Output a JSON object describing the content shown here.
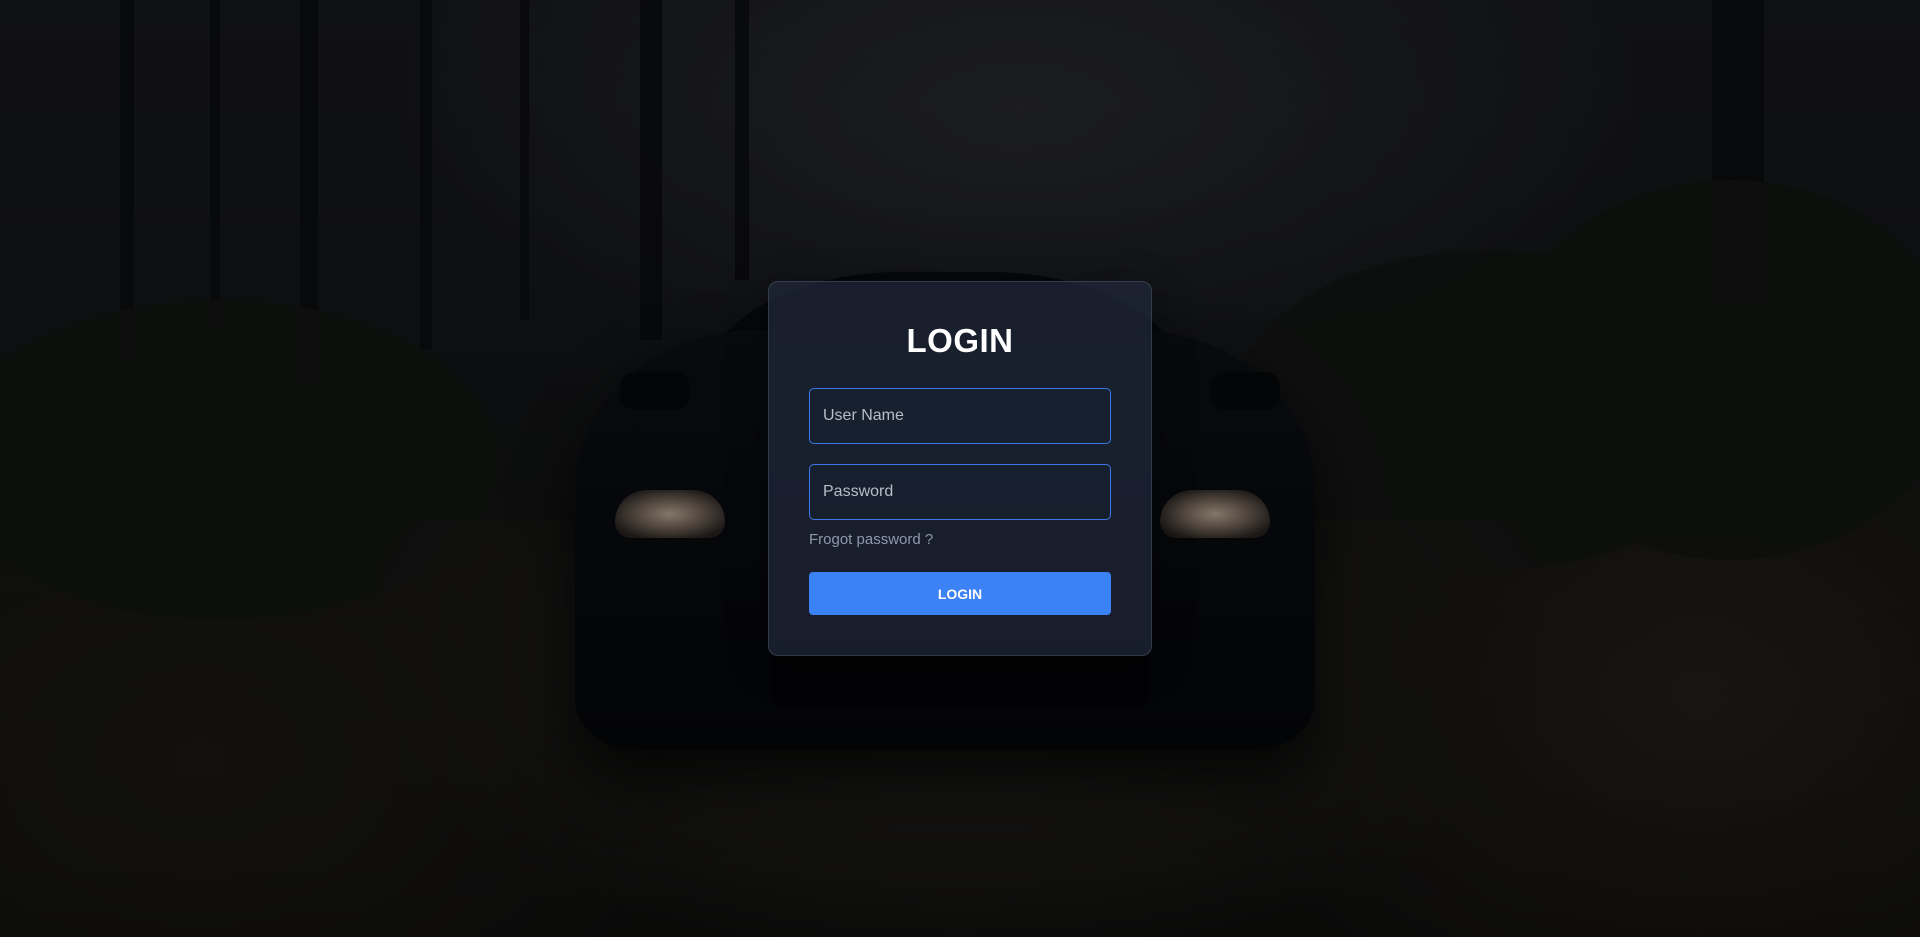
{
  "login": {
    "title": "LOGIN",
    "username_placeholder": "User Name",
    "username_value": "",
    "password_placeholder": "Password",
    "password_value": "",
    "forgot_label": "Frogot password ?",
    "submit_label": "LOGIN"
  },
  "colors": {
    "accent": "#3b82f6",
    "input_border": "#3b78e7",
    "card_background": "#20283a",
    "title_text": "#ffffff",
    "link_text": "#8f99ab"
  }
}
